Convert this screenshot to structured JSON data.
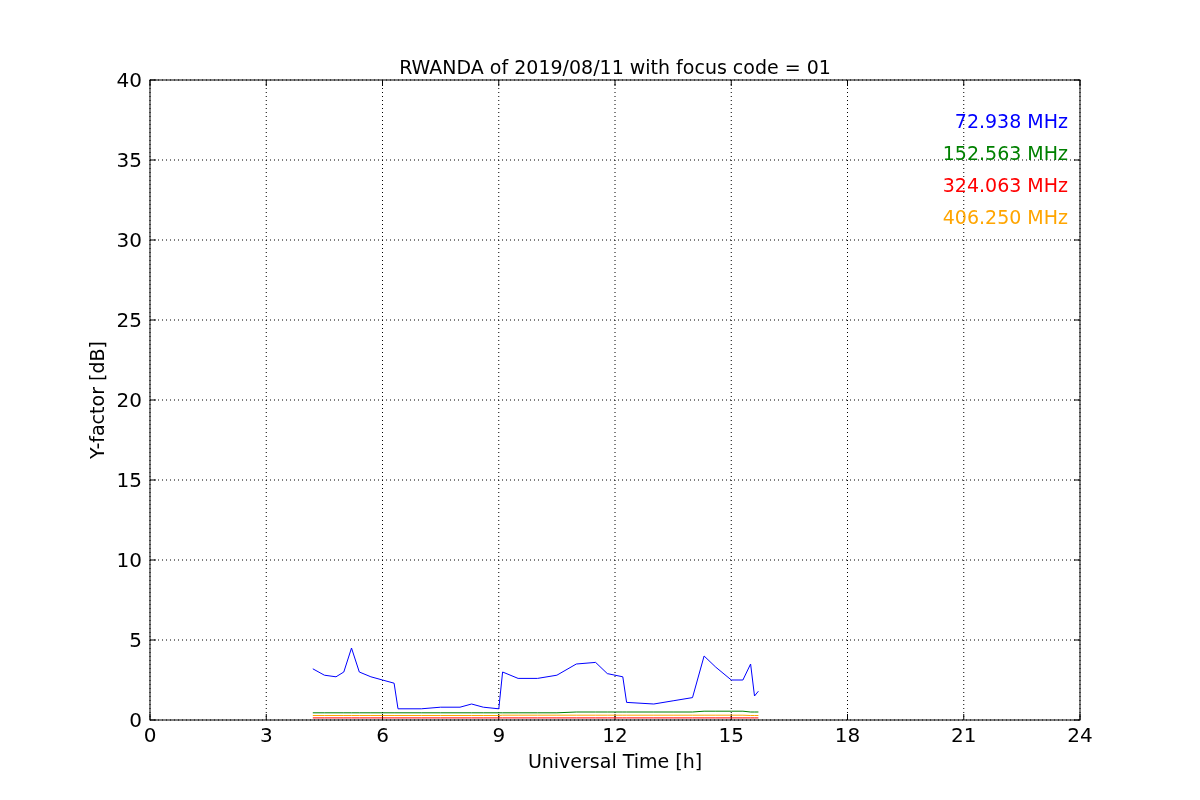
{
  "figure": {
    "chart_data": {
      "type": "line",
      "title": "RWANDA of 2019/08/11 with focus code = 01",
      "xlabel": "Universal Time [h]",
      "ylabel": "Y-factor [dB]",
      "x": [
        4.2,
        4.5,
        4.8,
        5.0,
        5.2,
        5.4,
        5.7,
        6.0,
        6.3,
        6.4,
        7.0,
        7.5,
        8.0,
        8.3,
        8.6,
        9.0,
        9.1,
        9.5,
        10.0,
        10.5,
        11.0,
        11.5,
        11.8,
        12.2,
        12.3,
        13.0,
        13.5,
        14.0,
        14.3,
        14.6,
        15.0,
        15.3,
        15.5,
        15.6,
        15.7
      ],
      "series": [
        {
          "name": "72.938 MHz",
          "color": "#0000ff",
          "values": [
            3.2,
            2.8,
            2.7,
            3.0,
            4.5,
            3.0,
            2.7,
            2.5,
            2.3,
            0.7,
            0.7,
            0.8,
            0.8,
            1.0,
            0.8,
            0.7,
            3.0,
            2.6,
            2.6,
            2.8,
            3.5,
            3.6,
            2.9,
            2.7,
            1.1,
            1.0,
            1.2,
            1.4,
            4.0,
            3.3,
            2.5,
            2.5,
            3.5,
            1.5,
            1.8
          ]
        },
        {
          "name": "152.563 MHz",
          "color": "#008000",
          "values": [
            0.45,
            0.45,
            0.45,
            0.45,
            0.45,
            0.45,
            0.45,
            0.45,
            0.45,
            0.45,
            0.45,
            0.45,
            0.45,
            0.45,
            0.45,
            0.45,
            0.45,
            0.45,
            0.45,
            0.45,
            0.5,
            0.5,
            0.5,
            0.5,
            0.5,
            0.5,
            0.5,
            0.5,
            0.55,
            0.55,
            0.55,
            0.55,
            0.5,
            0.5,
            0.5
          ]
        },
        {
          "name": "324.063 MHz",
          "color": "#ff0000",
          "values": [
            0.13,
            0.13,
            0.13,
            0.13,
            0.13,
            0.13,
            0.13,
            0.13,
            0.13,
            0.13,
            0.13,
            0.13,
            0.13,
            0.13,
            0.13,
            0.13,
            0.13,
            0.13,
            0.13,
            0.13,
            0.13,
            0.13,
            0.13,
            0.13,
            0.13,
            0.13,
            0.13,
            0.13,
            0.13,
            0.13,
            0.13,
            0.13,
            0.13,
            0.13,
            0.13
          ]
        },
        {
          "name": "406.250 MHz",
          "color": "#ffa500",
          "values": [
            0.28,
            0.28,
            0.28,
            0.28,
            0.28,
            0.28,
            0.28,
            0.28,
            0.28,
            0.28,
            0.28,
            0.28,
            0.28,
            0.28,
            0.28,
            0.28,
            0.3,
            0.3,
            0.3,
            0.3,
            0.3,
            0.3,
            0.3,
            0.3,
            0.3,
            0.3,
            0.3,
            0.3,
            0.3,
            0.3,
            0.3,
            0.3,
            0.28,
            0.28,
            0.28
          ]
        }
      ],
      "xlim": [
        0,
        24
      ],
      "ylim": [
        0,
        40
      ],
      "xticks": [
        0,
        3,
        6,
        9,
        12,
        15,
        18,
        21,
        24
      ],
      "yticks": [
        0,
        5,
        10,
        15,
        20,
        25,
        30,
        35,
        40
      ],
      "grid": true
    }
  }
}
